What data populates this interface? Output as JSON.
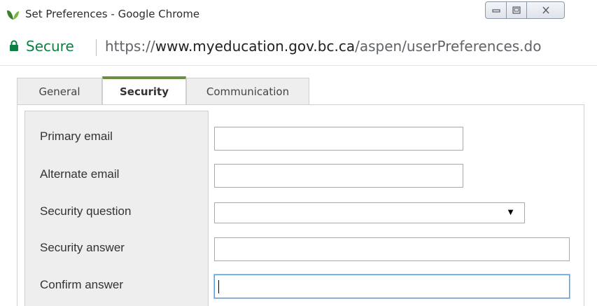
{
  "window": {
    "title": "Set Preferences - Google Chrome"
  },
  "address_bar": {
    "security_label": "Secure",
    "url_scheme": "https://",
    "url_host": "www.myeducation.gov.bc.ca",
    "url_path": "/aspen/userPreferences.do"
  },
  "tabs": [
    {
      "label": "General",
      "active": false
    },
    {
      "label": "Security",
      "active": true
    },
    {
      "label": "Communication",
      "active": false
    }
  ],
  "form": {
    "primary_email": {
      "label": "Primary email",
      "value": ""
    },
    "alternate_email": {
      "label": "Alternate email",
      "value": ""
    },
    "security_question": {
      "label": "Security question",
      "selected": ""
    },
    "security_answer": {
      "label": "Security answer",
      "value": ""
    },
    "confirm_answer": {
      "label": "Confirm answer",
      "value": ""
    }
  },
  "colors": {
    "secure_green": "#0b8043",
    "active_tab_accent": "#6a8f3e",
    "focus_border": "#5b9bd5"
  },
  "icons": {
    "app": "chrome-leaf-icon",
    "lock": "lock-icon",
    "dropdown": "dropdown-arrow-icon"
  }
}
